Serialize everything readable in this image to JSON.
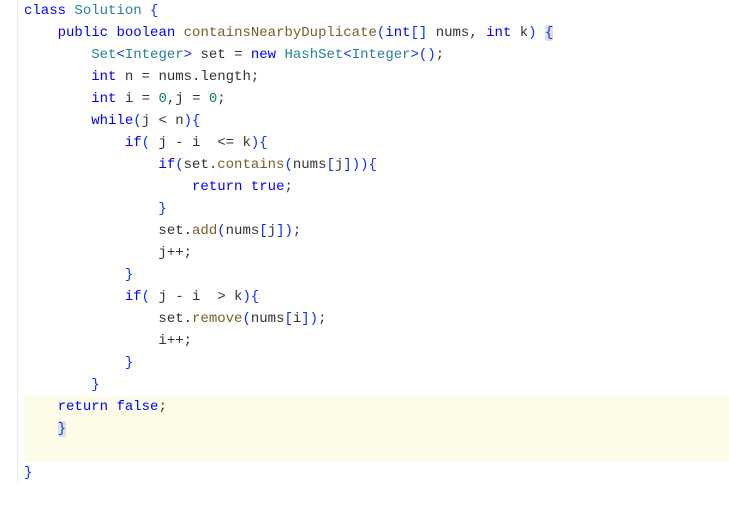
{
  "code": {
    "tokens": [
      [
        {
          "t": "kw",
          "v": "class"
        },
        {
          "t": "plain",
          "v": " "
        },
        {
          "t": "type",
          "v": "Solution"
        },
        {
          "t": "plain",
          "v": " "
        },
        {
          "t": "br",
          "v": "{"
        }
      ],
      [
        {
          "t": "plain",
          "v": "    "
        },
        {
          "t": "kw",
          "v": "public"
        },
        {
          "t": "plain",
          "v": " "
        },
        {
          "t": "kw",
          "v": "boolean"
        },
        {
          "t": "plain",
          "v": " "
        },
        {
          "t": "method",
          "v": "containsNearbyDuplicate"
        },
        {
          "t": "br",
          "v": "("
        },
        {
          "t": "kw",
          "v": "int"
        },
        {
          "t": "br",
          "v": "[]"
        },
        {
          "t": "plain",
          "v": " nums, "
        },
        {
          "t": "kw",
          "v": "int"
        },
        {
          "t": "plain",
          "v": " k"
        },
        {
          "t": "br",
          "v": ")"
        },
        {
          "t": "plain",
          "v": " "
        },
        {
          "t": "br hb",
          "v": "{"
        }
      ],
      [
        {
          "t": "plain",
          "v": "        "
        },
        {
          "t": "type",
          "v": "Set"
        },
        {
          "t": "br",
          "v": "<"
        },
        {
          "t": "type",
          "v": "Integer"
        },
        {
          "t": "br",
          "v": ">"
        },
        {
          "t": "plain",
          "v": " set = "
        },
        {
          "t": "kw",
          "v": "new"
        },
        {
          "t": "plain",
          "v": " "
        },
        {
          "t": "type",
          "v": "HashSet"
        },
        {
          "t": "br",
          "v": "<"
        },
        {
          "t": "type",
          "v": "Integer"
        },
        {
          "t": "br",
          "v": ">()"
        },
        {
          "t": "plain",
          "v": ";"
        }
      ],
      [
        {
          "t": "plain",
          "v": "        "
        },
        {
          "t": "kw",
          "v": "int"
        },
        {
          "t": "plain",
          "v": " n = nums.length;"
        }
      ],
      [
        {
          "t": "plain",
          "v": "        "
        },
        {
          "t": "kw",
          "v": "int"
        },
        {
          "t": "plain",
          "v": " i = "
        },
        {
          "t": "num",
          "v": "0"
        },
        {
          "t": "plain",
          "v": ",j = "
        },
        {
          "t": "num",
          "v": "0"
        },
        {
          "t": "plain",
          "v": ";"
        }
      ],
      [
        {
          "t": "plain",
          "v": "        "
        },
        {
          "t": "kw",
          "v": "while"
        },
        {
          "t": "br",
          "v": "("
        },
        {
          "t": "plain",
          "v": "j < n"
        },
        {
          "t": "br",
          "v": "){"
        }
      ],
      [
        {
          "t": "plain",
          "v": "            "
        },
        {
          "t": "kw",
          "v": "if"
        },
        {
          "t": "br",
          "v": "("
        },
        {
          "t": "plain",
          "v": " j - i  <= k"
        },
        {
          "t": "br",
          "v": "){"
        }
      ],
      [
        {
          "t": "plain",
          "v": "                "
        },
        {
          "t": "kw",
          "v": "if"
        },
        {
          "t": "br",
          "v": "("
        },
        {
          "t": "plain",
          "v": "set."
        },
        {
          "t": "method",
          "v": "contains"
        },
        {
          "t": "br",
          "v": "("
        },
        {
          "t": "plain",
          "v": "nums"
        },
        {
          "t": "br",
          "v": "["
        },
        {
          "t": "plain",
          "v": "j"
        },
        {
          "t": "br",
          "v": "])){"
        }
      ],
      [
        {
          "t": "plain",
          "v": "                    "
        },
        {
          "t": "kw",
          "v": "return"
        },
        {
          "t": "plain",
          "v": " "
        },
        {
          "t": "kw",
          "v": "true"
        },
        {
          "t": "plain",
          "v": ";"
        }
      ],
      [
        {
          "t": "plain",
          "v": "                "
        },
        {
          "t": "br",
          "v": "}"
        }
      ],
      [
        {
          "t": "plain",
          "v": "                set."
        },
        {
          "t": "method",
          "v": "add"
        },
        {
          "t": "br",
          "v": "("
        },
        {
          "t": "plain",
          "v": "nums"
        },
        {
          "t": "br",
          "v": "["
        },
        {
          "t": "plain",
          "v": "j"
        },
        {
          "t": "br",
          "v": "])"
        },
        {
          "t": "plain",
          "v": ";"
        }
      ],
      [
        {
          "t": "plain",
          "v": "                j++;"
        }
      ],
      [
        {
          "t": "plain",
          "v": "            "
        },
        {
          "t": "br",
          "v": "}"
        }
      ],
      [
        {
          "t": "plain",
          "v": "            "
        },
        {
          "t": "kw",
          "v": "if"
        },
        {
          "t": "br",
          "v": "("
        },
        {
          "t": "plain",
          "v": " j - i  > k"
        },
        {
          "t": "br",
          "v": "){"
        }
      ],
      [
        {
          "t": "plain",
          "v": "                set."
        },
        {
          "t": "method",
          "v": "remove"
        },
        {
          "t": "br",
          "v": "("
        },
        {
          "t": "plain",
          "v": "nums"
        },
        {
          "t": "br",
          "v": "["
        },
        {
          "t": "plain",
          "v": "i"
        },
        {
          "t": "br",
          "v": "])"
        },
        {
          "t": "plain",
          "v": ";"
        }
      ],
      [
        {
          "t": "plain",
          "v": "                i++;"
        }
      ],
      [
        {
          "t": "plain",
          "v": "            "
        },
        {
          "t": "br",
          "v": "}"
        }
      ],
      [
        {
          "t": "plain",
          "v": "        "
        },
        {
          "t": "br",
          "v": "}"
        }
      ],
      [
        {
          "t": "plain",
          "v": "    "
        },
        {
          "t": "kw",
          "v": "return"
        },
        {
          "t": "plain",
          "v": " "
        },
        {
          "t": "kw",
          "v": "false"
        },
        {
          "t": "plain",
          "v": ";"
        }
      ],
      [
        {
          "t": "plain",
          "v": "    "
        },
        {
          "t": "br hb",
          "v": "}"
        }
      ],
      [
        {
          "t": "plain",
          "v": ""
        }
      ],
      [
        {
          "t": "br",
          "v": "}"
        }
      ]
    ],
    "highlight_lines": [
      18,
      19,
      20
    ]
  }
}
